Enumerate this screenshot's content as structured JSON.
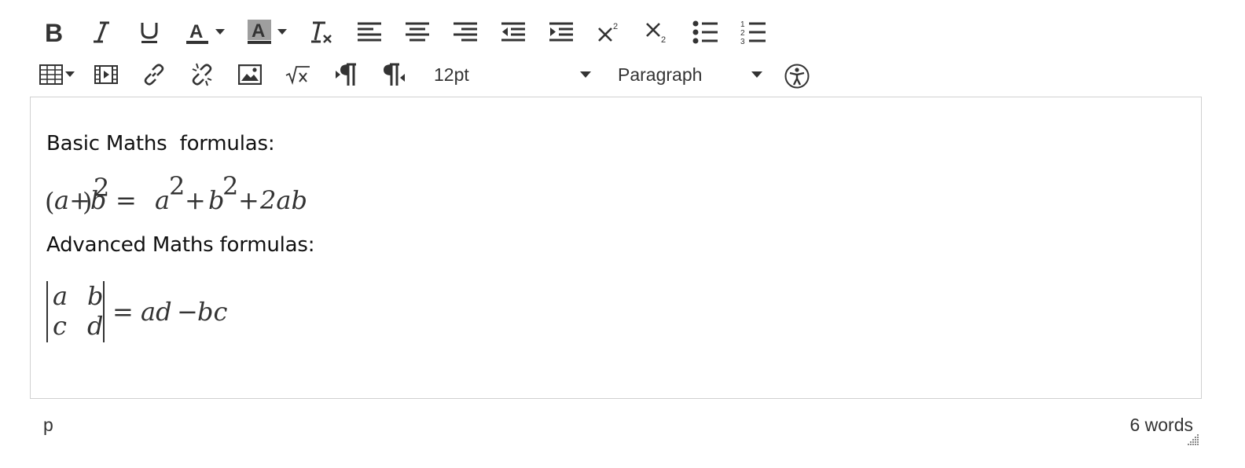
{
  "toolbar": {
    "row1": [
      {
        "name": "bold-icon",
        "label": "Bold"
      },
      {
        "name": "italic-icon",
        "label": "Italic"
      },
      {
        "name": "underline-icon",
        "label": "Underline"
      },
      {
        "name": "text-color-icon",
        "label": "Text color"
      },
      {
        "name": "background-color-icon",
        "label": "Background color"
      },
      {
        "name": "clear-formatting-icon",
        "label": "Clear formatting"
      },
      {
        "name": "align-left-icon",
        "label": "Align left"
      },
      {
        "name": "align-center-icon",
        "label": "Align center"
      },
      {
        "name": "align-right-icon",
        "label": "Align right"
      },
      {
        "name": "outdent-icon",
        "label": "Decrease indent"
      },
      {
        "name": "indent-icon",
        "label": "Increase indent"
      },
      {
        "name": "superscript-icon",
        "label": "Superscript"
      },
      {
        "name": "subscript-icon",
        "label": "Subscript"
      },
      {
        "name": "bullet-list-icon",
        "label": "Bullet list"
      },
      {
        "name": "numbered-list-icon",
        "label": "Numbered list"
      }
    ],
    "row2": [
      {
        "name": "table-icon",
        "label": "Table"
      },
      {
        "name": "media-icon",
        "label": "Media"
      },
      {
        "name": "link-icon",
        "label": "Link"
      },
      {
        "name": "unlink-icon",
        "label": "Remove link"
      },
      {
        "name": "image-icon",
        "label": "Image"
      },
      {
        "name": "equation-icon",
        "label": "Equation"
      },
      {
        "name": "ltr-icon",
        "label": "Left to right"
      },
      {
        "name": "rtl-icon",
        "label": "Right to left"
      }
    ],
    "font_size": {
      "value": "12pt"
    },
    "block_format": {
      "value": "Paragraph"
    },
    "accessibility": {
      "name": "accessibility-icon",
      "label": "Accessibility checker"
    }
  },
  "content": {
    "heading1": "Basic Maths  formulas:",
    "heading2": "Advanced Maths formulas:",
    "formula1": {
      "paren_open": "(",
      "inner": "a+b",
      "paren_close": ")",
      "exp": "2",
      "equals": "=",
      "a": "a",
      "a_exp": "2",
      "plus1": "+",
      "b": "b",
      "b_exp": "2",
      "plus2": "+",
      "term": "2ab"
    },
    "formula2": {
      "m11": "a",
      "m12": "b",
      "m21": "c",
      "m22": "d",
      "equals": "=",
      "rhs": "ad",
      "minus": "−",
      "rhs2": "bc"
    }
  },
  "status": {
    "path": "p",
    "word_count": "6 words"
  },
  "colors": {
    "icon": "#333333",
    "border": "#d0d0d0",
    "highlight": "#9e9e9e"
  }
}
